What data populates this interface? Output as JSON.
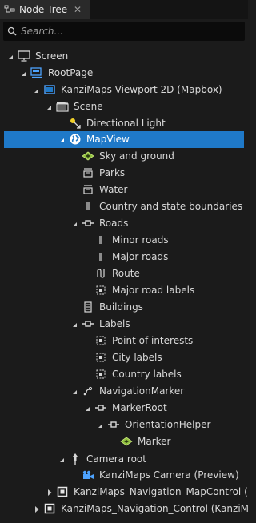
{
  "panel": {
    "tab_title": "Node Tree",
    "tab_close": "✕"
  },
  "search": {
    "placeholder": "Search..."
  },
  "tree": {
    "rows": [
      {
        "label": "Screen"
      },
      {
        "label": "RootPage"
      },
      {
        "label": "KanziMaps Viewport 2D (Mapbox)"
      },
      {
        "label": "Scene"
      },
      {
        "label": "Directional Light"
      },
      {
        "label": "MapView",
        "selected": true
      },
      {
        "label": "Sky and ground"
      },
      {
        "label": "Parks"
      },
      {
        "label": "Water"
      },
      {
        "label": "Country and state boundaries"
      },
      {
        "label": "Roads"
      },
      {
        "label": "Minor roads"
      },
      {
        "label": "Major roads"
      },
      {
        "label": "Route"
      },
      {
        "label": "Major road labels"
      },
      {
        "label": "Buildings"
      },
      {
        "label": "Labels"
      },
      {
        "label": "Point of interests"
      },
      {
        "label": "City labels"
      },
      {
        "label": "Country labels"
      },
      {
        "label": "NavigationMarker"
      },
      {
        "label": "MarkerRoot"
      },
      {
        "label": "OrientationHelper"
      },
      {
        "label": "Marker"
      },
      {
        "label": "Camera root"
      },
      {
        "label": "KanziMaps Camera (Preview)"
      },
      {
        "label": "KanziMaps_Navigation_MapControl (Ka"
      },
      {
        "label": "KanziMaps_Navigation_Control (KanziMap"
      }
    ]
  },
  "colors": {
    "selection": "#1f79c8",
    "background": "#1b1b1b",
    "icon_blue": "#4da3ff",
    "icon_green": "#8fbf3f",
    "icon_yellow": "#f0d02a"
  }
}
